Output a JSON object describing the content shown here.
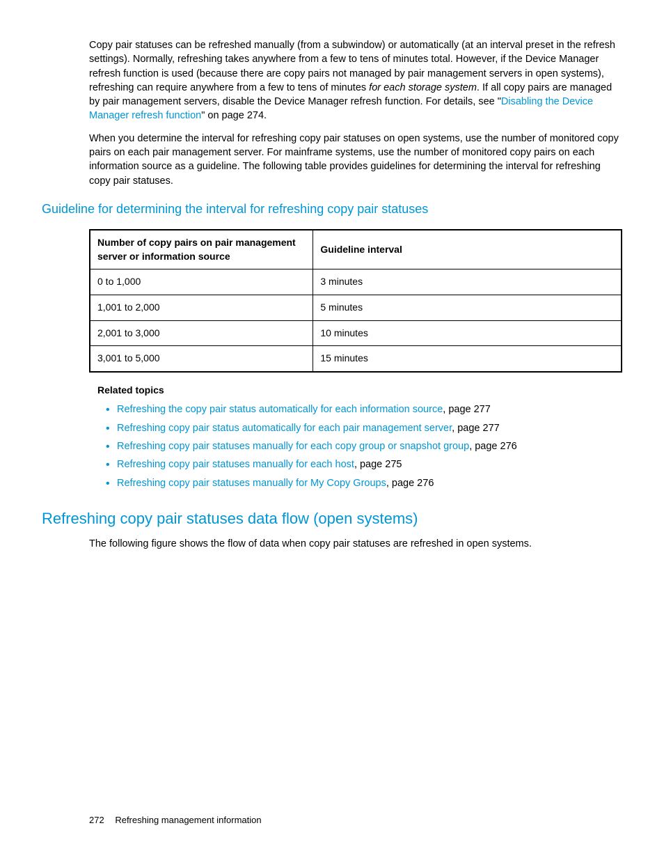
{
  "para1": {
    "t1": "Copy pair statuses can be refreshed manually (from a subwindow) or automatically (at an interval preset in the refresh settings). Normally, refreshing takes anywhere from a few to tens of minutes total. However, if the Device Manager refresh function is used (because there are copy pairs not managed by pair management servers in open systems), refreshing can require anywhere from a few to tens of minutes ",
    "italic": "for each storage system",
    "t2": ". If all copy pairs are managed by pair management servers, disable the Device Manager refresh function. For details, see \"",
    "link": "Disabling the Device Manager refresh function",
    "t3": "\" on page 274."
  },
  "para2": "When you determine the interval for refreshing copy pair statuses on open systems, use the number of monitored copy pairs on each pair management server. For mainframe systems, use the number of monitored copy pairs on each information source as a guideline. The following table provides guidelines for determining the interval for refreshing copy pair statuses.",
  "subheading": "Guideline for determining the interval for refreshing copy pair statuses",
  "table": {
    "h1": "Number of copy pairs on pair management server or information source",
    "h2": "Guideline interval",
    "rows": [
      {
        "c1": "0 to 1,000",
        "c2": "3 minutes"
      },
      {
        "c1": "1,001 to 2,000",
        "c2": "5 minutes"
      },
      {
        "c1": "2,001 to 3,000",
        "c2": "10 minutes"
      },
      {
        "c1": "3,001 to 5,000",
        "c2": "15 minutes"
      }
    ]
  },
  "related_label": "Related topics",
  "topics": [
    {
      "link": "Refreshing the copy pair status automatically for each information source",
      "suffix": ", page 277"
    },
    {
      "link": "Refreshing copy pair status automatically for each pair management server",
      "suffix": ", page 277"
    },
    {
      "link": "Refreshing copy pair statuses manually for each copy group or snapshot group",
      "suffix": ", page 276"
    },
    {
      "link": "Refreshing copy pair statuses manually for each host",
      "suffix": ", page 275"
    },
    {
      "link": "Refreshing copy pair statuses manually for My Copy Groups",
      "suffix": ", page 276"
    }
  ],
  "heading2": "Refreshing copy pair statuses data flow (open systems)",
  "para3": "The following figure shows the flow of data when copy pair statuses are refreshed in open systems.",
  "footer": {
    "page": "272",
    "title": "Refreshing management information"
  }
}
